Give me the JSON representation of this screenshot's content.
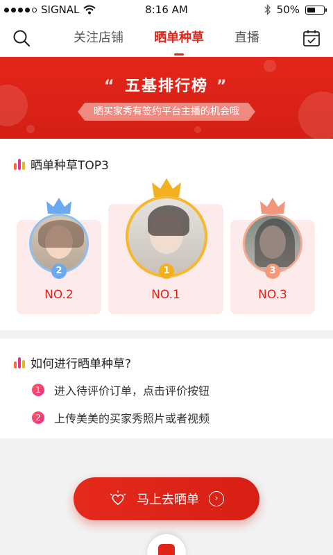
{
  "status_bar": {
    "carrier": "SIGNAL",
    "time": "8:16 AM",
    "battery": "50%",
    "battery_level": 0.5
  },
  "nav": {
    "tabs": [
      {
        "label": "关注店铺",
        "active": false
      },
      {
        "label": "晒单种草",
        "active": true
      },
      {
        "label": "直播",
        "active": false
      }
    ],
    "icons": {
      "left": "search-icon",
      "right": "calendar-check-icon"
    }
  },
  "banner": {
    "title": "五基排行榜",
    "subtitle": "晒买家秀有签约平台主播的机会哦",
    "open_quote": "“",
    "close_quote": "”"
  },
  "top3": {
    "heading": "晒单种草TOP3",
    "cards": [
      {
        "rank": "2",
        "label": "NO.2",
        "crown_color": "#6aa8f0"
      },
      {
        "rank": "1",
        "label": "NO.1",
        "crown_color": "#f2b01e"
      },
      {
        "rank": "3",
        "label": "NO.3",
        "crown_color": "#f2967a"
      }
    ]
  },
  "how": {
    "heading": "如何进行晒单种草?",
    "steps": [
      {
        "num": "1",
        "text": "进入待评价订单，点击评价按钮"
      },
      {
        "num": "2",
        "text": "上传美美的买家秀照片或者视频"
      }
    ]
  },
  "cta": {
    "label": "马上去晒单",
    "arrow": "›"
  },
  "colors": {
    "accent": "#e0241a",
    "card_bg": "#fdeaea"
  }
}
